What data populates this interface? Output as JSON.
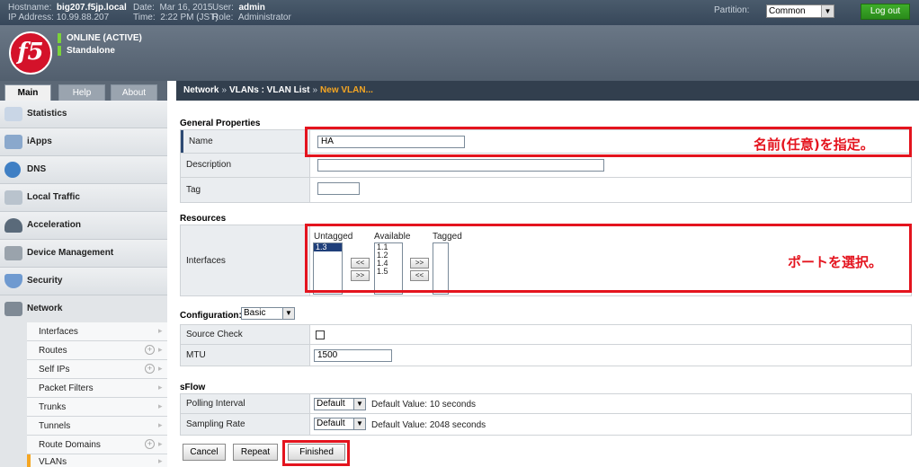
{
  "topbar": {
    "hostname_label": "Hostname:",
    "hostname": "big207.f5jp.local",
    "ip_label": "IP Address:",
    "ip": "10.99.88.207",
    "date_label": "Date:",
    "date": "Mar 16, 2015",
    "time_label": "Time:",
    "time": "2:22 PM (JST)",
    "user_label": "User:",
    "user": "admin",
    "role_label": "Role:",
    "role": "Administrator",
    "partition_label": "Partition:",
    "partition": "Common",
    "logout": "Log out"
  },
  "header": {
    "logo": "f5",
    "status": "ONLINE (ACTIVE)",
    "mode": "Standalone"
  },
  "tabs": [
    "Main",
    "Help",
    "About"
  ],
  "sidebar": {
    "items": [
      {
        "label": "Statistics",
        "icon": "statistics-icon",
        "color": "#c9d6e6"
      },
      {
        "label": "iApps",
        "icon": "iapps-icon",
        "color": "#8aa8cc"
      },
      {
        "label": "DNS",
        "icon": "dns-globe-icon",
        "color": "#3f7fc4"
      },
      {
        "label": "Local Traffic",
        "icon": "local-traffic-icon",
        "color": "#b9c3cd"
      },
      {
        "label": "Acceleration",
        "icon": "acceleration-icon",
        "color": "#5a6a7a"
      },
      {
        "label": "Device Management",
        "icon": "device-management-icon",
        "color": "#9aa3ac"
      },
      {
        "label": "Security",
        "icon": "security-shield-icon",
        "color": "#6f9ad0"
      },
      {
        "label": "Network",
        "icon": "network-icon",
        "color": "#7f8a95"
      }
    ],
    "network_sub": [
      {
        "label": "Interfaces",
        "plus": false
      },
      {
        "label": "Routes",
        "plus": true
      },
      {
        "label": "Self IPs",
        "plus": true
      },
      {
        "label": "Packet Filters",
        "plus": false
      },
      {
        "label": "Trunks",
        "plus": false
      },
      {
        "label": "Tunnels",
        "plus": false
      },
      {
        "label": "Route Domains",
        "plus": true
      },
      {
        "label": "VLANs",
        "plus": false
      }
    ]
  },
  "breadcrumb": {
    "part1": "Network",
    "sep": "»",
    "part2": "VLANs : VLAN List",
    "current": "New VLAN..."
  },
  "general": {
    "title": "General Properties",
    "name_label": "Name",
    "name_value": "HA",
    "description_label": "Description",
    "description_value": "",
    "tag_label": "Tag",
    "tag_value": ""
  },
  "resources": {
    "title": "Resources",
    "interfaces_label": "Interfaces",
    "untagged_label": "Untagged",
    "untagged_items": [
      "1.3"
    ],
    "available_label": "Available",
    "available_items": [
      "1.1",
      "1.2",
      "1.4",
      "1.5"
    ],
    "tagged_label": "Tagged",
    "tagged_items": [],
    "btn_left": "<<",
    "btn_right": ">>"
  },
  "configuration": {
    "label": "Configuration:",
    "mode": "Basic",
    "source_check_label": "Source Check",
    "mtu_label": "MTU",
    "mtu_value": "1500"
  },
  "sflow": {
    "title": "sFlow",
    "polling_label": "Polling Interval",
    "polling_value": "Default",
    "polling_hint": "Default Value: 10 seconds",
    "sampling_label": "Sampling Rate",
    "sampling_value": "Default",
    "sampling_hint": "Default Value: 2048 seconds"
  },
  "buttons": {
    "cancel": "Cancel",
    "repeat": "Repeat",
    "finished": "Finished"
  },
  "annotations": {
    "name_note": "名前(任意)を指定。",
    "port_note": "ポートを選択。"
  },
  "colors": {
    "annotation_red": "#e4141e",
    "online_green": "#7bd33a",
    "brand_red": "#d4122a"
  }
}
